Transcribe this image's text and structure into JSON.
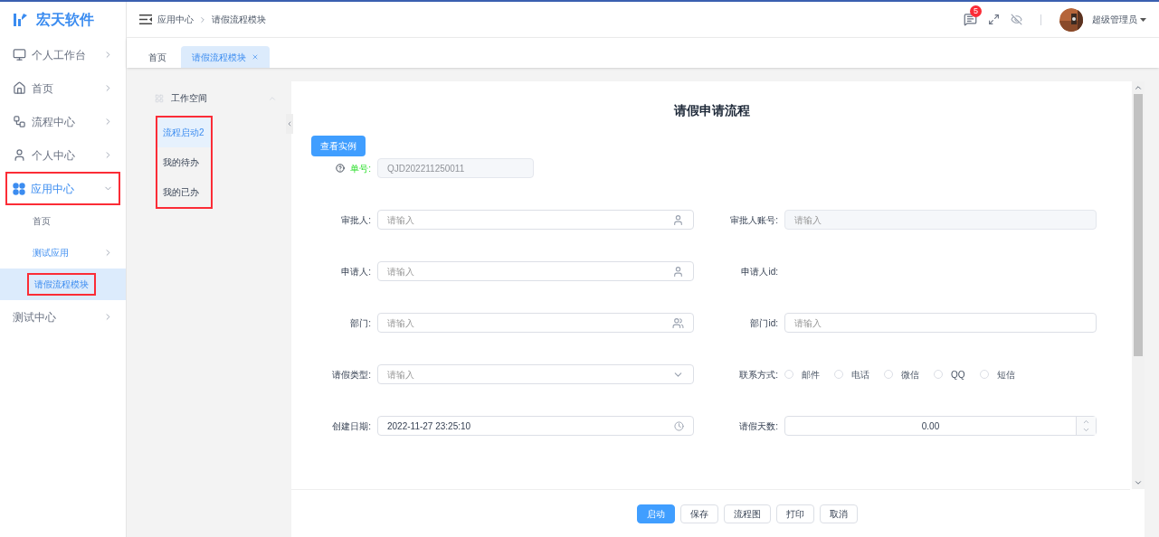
{
  "brand": {
    "name": "宏天软件"
  },
  "sidebar": {
    "items": [
      {
        "label": "个人工作台",
        "expanded": false,
        "highlighted": false
      },
      {
        "label": "首页",
        "expanded": false,
        "highlighted": false
      },
      {
        "label": "流程中心",
        "expanded": false,
        "highlighted": false
      },
      {
        "label": "个人中心",
        "expanded": false,
        "highlighted": false
      },
      {
        "label": "应用中心",
        "expanded": true,
        "highlighted": true,
        "children": [
          {
            "label": "首页",
            "selected": false,
            "arrow": false,
            "highlighted": false
          },
          {
            "label": "测试应用",
            "selected": false,
            "arrow": true,
            "highlighted": false
          },
          {
            "label": "请假流程模块",
            "selected": true,
            "arrow": false,
            "highlighted": true
          }
        ]
      },
      {
        "label": "测试中心",
        "expanded": false,
        "highlighted": false
      }
    ]
  },
  "breadcrumb": [
    "应用中心",
    "请假流程模块"
  ],
  "header": {
    "badge": "5",
    "user": "超级管理员"
  },
  "tabs": [
    {
      "label": "首页",
      "selected": false,
      "closable": false
    },
    {
      "label": "请假流程模块",
      "selected": true,
      "closable": true
    }
  ],
  "workspace": {
    "title": "工作空间",
    "highlighted": true,
    "items": [
      {
        "label": "流程启动2",
        "selected": true
      },
      {
        "label": "我的待办",
        "selected": false
      },
      {
        "label": "我的已办",
        "selected": false
      }
    ]
  },
  "form": {
    "title": "请假申请流程",
    "example_button": "查看实例",
    "number": {
      "label": "单号:",
      "value": "QJD202211250011"
    },
    "rows": [
      [
        {
          "label": "审批人:",
          "kind": "person",
          "placeholder": "请输入"
        },
        {
          "label": "审批人账号:",
          "kind": "disabled",
          "placeholder": "请输入"
        }
      ],
      [
        {
          "label": "申请人:",
          "kind": "person",
          "placeholder": "请输入"
        },
        {
          "label": "申请人id:",
          "kind": "text"
        }
      ],
      [
        {
          "label": "部门:",
          "kind": "dept",
          "placeholder": "请输入"
        },
        {
          "label": "部门id:",
          "kind": "input",
          "placeholder": "请输入"
        }
      ],
      [
        {
          "label": "请假类型:",
          "kind": "select",
          "placeholder": "请输入"
        },
        {
          "label": "联系方式:",
          "kind": "radio",
          "options": [
            {
              "label": "邮件",
              "selected": false
            },
            {
              "label": "电话",
              "selected": false
            },
            {
              "label": "微信",
              "selected": false
            },
            {
              "label": "QQ",
              "selected": false
            },
            {
              "label": "短信",
              "selected": false
            }
          ]
        }
      ],
      [
        {
          "label": "创建日期:",
          "kind": "datetime",
          "value": "2022-11-27 23:25:10"
        },
        {
          "label": "请假天数:",
          "kind": "number",
          "value": "0.00"
        }
      ]
    ],
    "buttons": [
      {
        "label": "启动",
        "primary": true
      },
      {
        "label": "保存",
        "primary": false
      },
      {
        "label": "流程图",
        "primary": false
      },
      {
        "label": "打印",
        "primary": false
      },
      {
        "label": "取消",
        "primary": false
      }
    ]
  }
}
